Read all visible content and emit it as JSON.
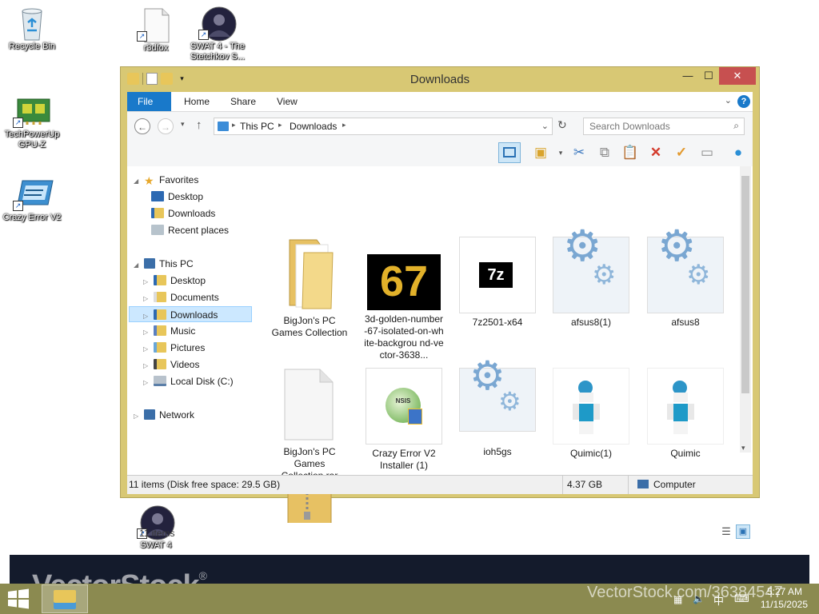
{
  "desktop": {
    "icons": [
      {
        "label": "Recycle Bin"
      },
      {
        "label": "r3dfox"
      },
      {
        "label": "SWAT 4 - The Stetchkov S..."
      },
      {
        "label": "TechPowerUp GPU-Z"
      },
      {
        "label": "Crazy Error V2"
      },
      {
        "label": "SWAT 4"
      }
    ]
  },
  "window": {
    "title": "Downloads",
    "ribbon_tabs": [
      "File",
      "Home",
      "Share",
      "View"
    ],
    "address": {
      "root": "This PC",
      "current": "Downloads"
    },
    "search_placeholder": "Search Downloads",
    "nav": {
      "favorites": "Favorites",
      "favorites_items": [
        "Desktop",
        "Downloads",
        "Recent places"
      ],
      "this_pc": "This PC",
      "this_pc_items": [
        "Desktop",
        "Documents",
        "Downloads",
        "Music",
        "Pictures",
        "Videos",
        "Local Disk (C:)"
      ],
      "network": "Network"
    },
    "files": [
      {
        "name": "BigJon's PC Games Collection",
        "type": "folder"
      },
      {
        "name": "3d-golden-number-67-isolated-on-white-backgrou nd-vector-3638...",
        "type": "image",
        "thumb_text": "67"
      },
      {
        "name": "7z2501-x64",
        "type": "installer",
        "thumb_text": "7z"
      },
      {
        "name": "afsus8(1)",
        "type": "exe"
      },
      {
        "name": "afsus8",
        "type": "exe"
      },
      {
        "name": "BigJon's PC Games Collection.rar",
        "type": "document"
      },
      {
        "name": "Crazy Error V2 Installer (1)",
        "type": "installer",
        "thumb_text": "NSIS"
      },
      {
        "name": "ioh5gs",
        "type": "exe"
      },
      {
        "name": "Quimic(1)",
        "type": "avatar"
      },
      {
        "name": "Quimic",
        "type": "avatar"
      }
    ],
    "item_count": "11 items",
    "status": {
      "summary": "11 items (Disk free space: 29.5 GB)",
      "size": "4.37 GB",
      "location": "Computer"
    }
  },
  "watermark": {
    "brand": "VectorStock",
    "reg": "®",
    "url": "VectorStock.com/36384547"
  },
  "taskbar": {
    "time": "5:27 AM",
    "date": "11/15/2025"
  },
  "colors": {
    "window_frame": "#d8c874",
    "taskbar": "#8b8a50",
    "selection": "#cce8ff",
    "file_tab": "#1979ca",
    "close_button": "#c75050"
  }
}
